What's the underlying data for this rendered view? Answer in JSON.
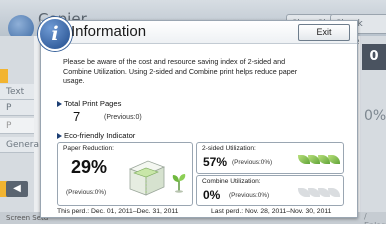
{
  "background": {
    "title": "Copier",
    "top_button_1": "Clear Sh",
    "top_button_2": "Check Mode",
    "right_counter": "0",
    "right_percent": "0%",
    "right_bottom": "/ Enlarg",
    "left_tabs": [
      "Text",
      "P",
      "P",
      "Genera"
    ],
    "left_arrow": "◀",
    "bottom_status": "Screen Setu"
  },
  "dialog": {
    "title": "Information",
    "exit_label": "Exit",
    "message": "Please be aware of the cost and resource saving index of 2-sided and Combine Utilization. Using 2-sided and Combine print helps reduce paper usage."
  },
  "total_print": {
    "heading": "Total Print Pages",
    "value": "7",
    "previous": "(Previous:0)"
  },
  "eco": {
    "heading": "Eco-friendly Indicator",
    "paper_reduction": {
      "label": "Paper Reduction:",
      "value": "29%",
      "previous": "(Previous:0%)"
    },
    "two_sided": {
      "label": "2-sided Utilization:",
      "value": "57%",
      "previous": "(Previous:0%)",
      "level": 4,
      "level_max": 4
    },
    "combine": {
      "label": "Combine Utilization:",
      "value": "0%",
      "previous": "(Previous:0%)",
      "level": 0,
      "level_max": 4
    }
  },
  "periods": {
    "current": "This perd.: Dec. 01, 2011–Dec. 31, 2011",
    "last": "Last perd.: Nov. 28, 2011–Nov. 30, 2011"
  },
  "colors": {
    "accent": "#214c8c",
    "leaf_on": "#62a53a",
    "leaf_off": "#dadde0"
  }
}
